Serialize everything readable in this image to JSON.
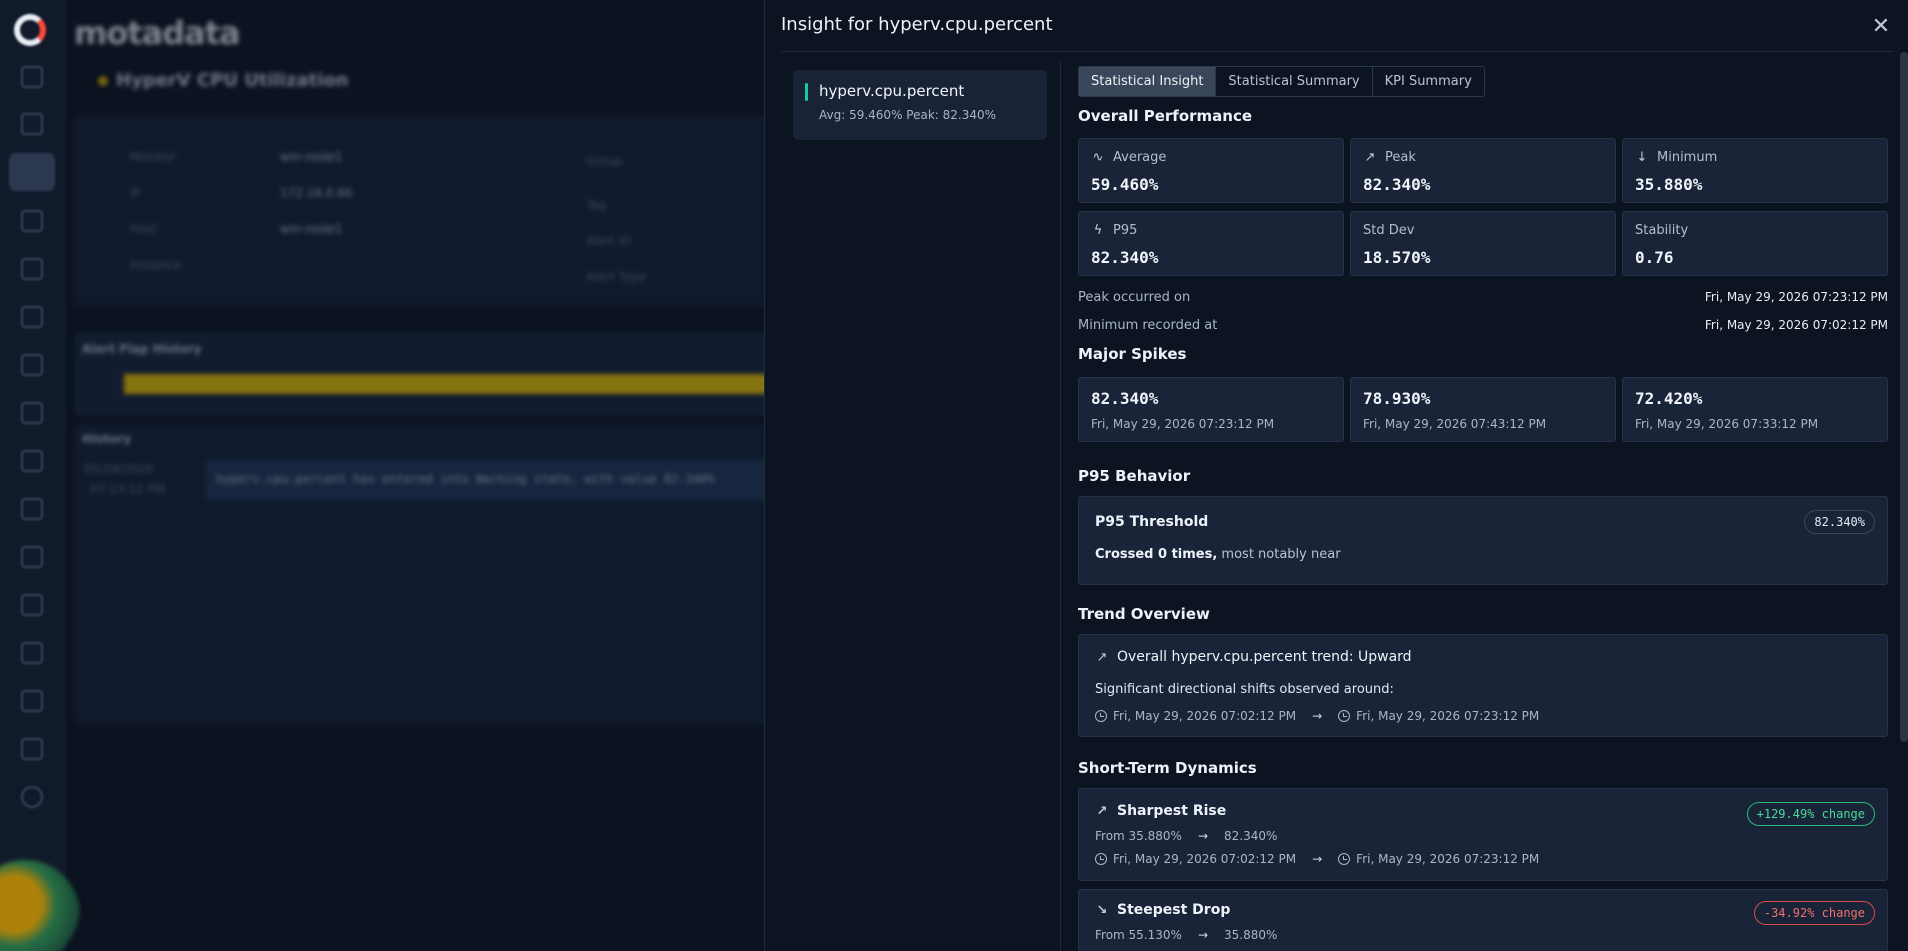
{
  "background": {
    "brand": "motadata",
    "page_title": "HyperV CPU Utilization",
    "details": {
      "labels": [
        "Monitor",
        "IP",
        "Host",
        "Instance",
        "Group",
        "Tag",
        "Alert ID",
        "Alert Type"
      ],
      "values": [
        "win-node1",
        "172.16.0.66",
        "win-node1"
      ]
    },
    "flap_history_label": "Alert Flap History",
    "history_label": "History",
    "history_time": [
      "05/29/2026",
      "07:23:12 PM"
    ],
    "history_message": "hyperv.cpu.percent has entered into Warning state, with value 82.340%"
  },
  "drawer": {
    "title": "Insight for hyperv.cpu.percent",
    "close_icon": "close-icon",
    "metric": {
      "name": "hyperv.cpu.percent",
      "summary": "Avg: 59.460%   Peak: 82.340%"
    },
    "tabs": [
      "Statistical Insight",
      "Statistical Summary",
      "KPI Summary"
    ],
    "active_tab": 0,
    "overall": {
      "heading": "Overall Performance",
      "stats": [
        {
          "label": "Average",
          "value": "59.460%",
          "icon": "activity-icon"
        },
        {
          "label": "Peak",
          "value": "82.340%",
          "icon": "trend-up-icon"
        },
        {
          "label": "Minimum",
          "value": "35.880%",
          "icon": "arrow-down-icon"
        },
        {
          "label": "P95",
          "value": "82.340%",
          "icon": "lightning-icon"
        },
        {
          "label": "Std Dev",
          "value": "18.570%",
          "icon": ""
        },
        {
          "label": "Stability",
          "value": "0.76",
          "icon": ""
        }
      ],
      "peak_label": "Peak occurred on",
      "peak_time": "Fri, May 29, 2026 07:23:12 PM",
      "min_label": "Minimum recorded at",
      "min_time": "Fri, May 29, 2026 07:02:12 PM"
    },
    "spikes": {
      "heading": "Major Spikes",
      "items": [
        {
          "value": "82.340%",
          "time": "Fri, May 29, 2026 07:23:12 PM"
        },
        {
          "value": "78.930%",
          "time": "Fri, May 29, 2026 07:43:12 PM"
        },
        {
          "value": "72.420%",
          "time": "Fri, May 29, 2026 07:33:12 PM"
        }
      ]
    },
    "p95": {
      "heading": "P95 Behavior",
      "title": "P95 Threshold",
      "value": "82.340%",
      "crossed": "Crossed 0 times,",
      "crossed_rest": " most notably near"
    },
    "trend": {
      "heading": "Trend Overview",
      "title": "Overall hyperv.cpu.percent trend: Upward",
      "shifts_text": "Significant directional shifts observed around:",
      "from": "Fri, May 29, 2026 07:02:12 PM",
      "to": "Fri, May 29, 2026 07:23:12 PM"
    },
    "dynamics": {
      "heading": "Short-Term Dynamics",
      "rise": {
        "title": "Sharpest Rise",
        "change": "+129.49% change",
        "from_text": "From 35.880%",
        "to_text": "82.340%",
        "from_time": "Fri, May 29, 2026 07:02:12 PM",
        "to_time": "Fri, May 29, 2026 07:23:12 PM"
      },
      "drop": {
        "title": "Steepest Drop",
        "change": "-34.92% change",
        "from_text": "From 55.130%",
        "to_text": "35.880%"
      }
    },
    "colors": {
      "accent_teal": "#1ec4a7",
      "positive": "#49d99a",
      "negative": "#f07070"
    }
  }
}
